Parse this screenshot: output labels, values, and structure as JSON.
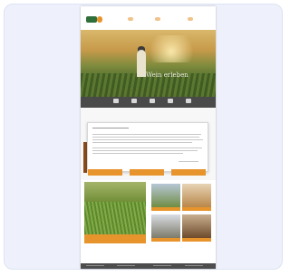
{
  "hero": {
    "title": "Wein erleben"
  },
  "colors": {
    "accent": "#e8942d",
    "dark_bar": "#4a4a4a",
    "logo_green": "#2f6f3a",
    "background": "#eef1fb"
  },
  "icons": [
    "logo-icon",
    "wine-icon",
    "map-icon",
    "calendar-icon",
    "user-icon",
    "shop-icon"
  ]
}
